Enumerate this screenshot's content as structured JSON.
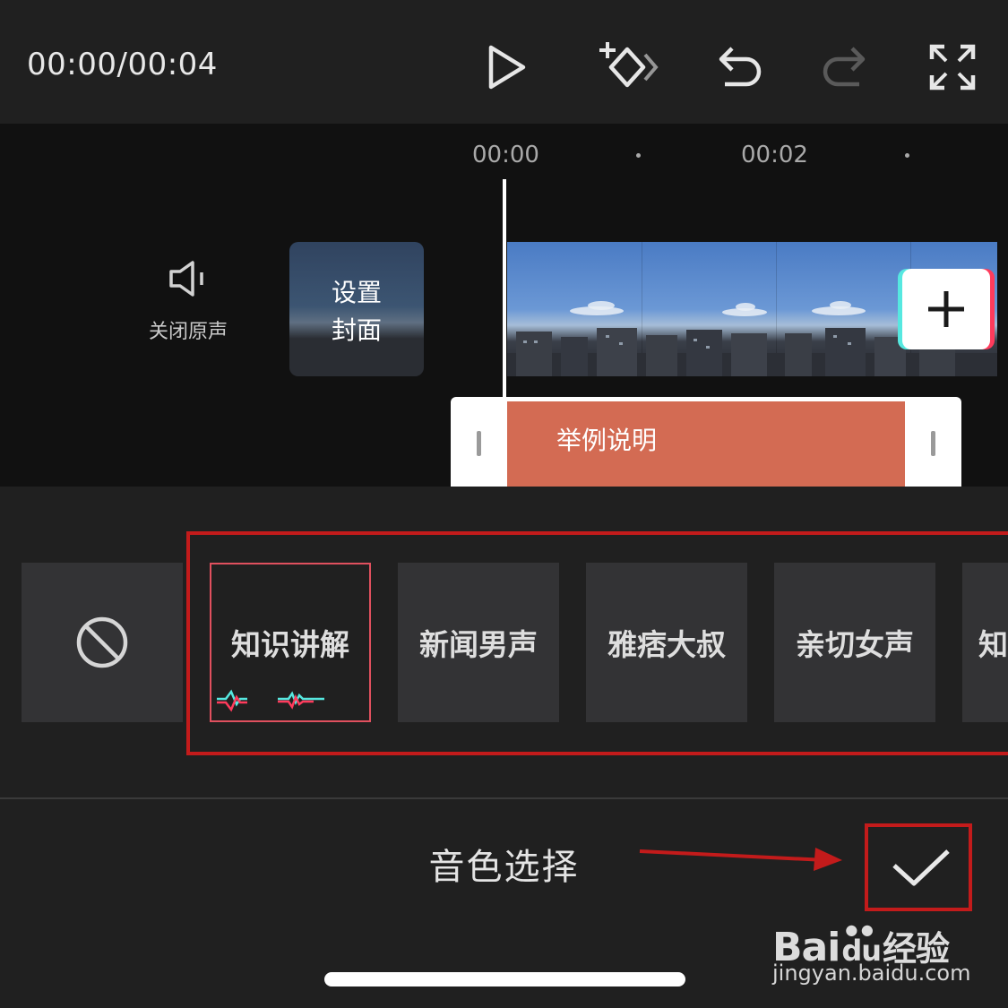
{
  "toolbar": {
    "timecode": "00:00/00:04",
    "icons": [
      "play-icon",
      "keyframe-icon",
      "undo-icon",
      "redo-icon",
      "fullscreen-icon"
    ]
  },
  "timeline": {
    "ruler": [
      "00:00",
      "00:02"
    ],
    "mute_label": "关闭原声",
    "cover_label": "设置\n封面",
    "text_clip_label": "举例说明"
  },
  "voices": {
    "none_icon": "disable-icon",
    "items": [
      "知识讲解",
      "新闻男声",
      "雅痞大叔",
      "亲切女声",
      "知"
    ],
    "selected_index": 0
  },
  "panel": {
    "title": "音色选择",
    "confirm_icon": "checkmark-icon"
  },
  "watermark": {
    "brand_a": "Bai",
    "brand_b": "du",
    "brand_c": "经验",
    "url": "jingyan.baidu.com"
  },
  "colors": {
    "accent_red": "#c31b1b",
    "text_clip": "#d36b53",
    "selected_border": "#e0505e",
    "cyan": "#56e8e0",
    "pink": "#ff3b5c"
  }
}
